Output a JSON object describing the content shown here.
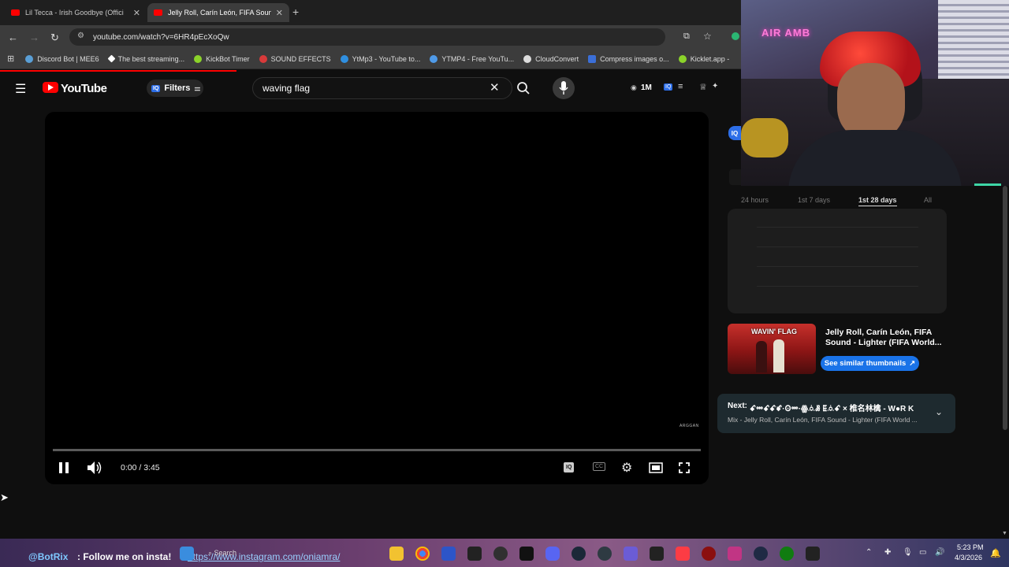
{
  "browser": {
    "tabs": [
      {
        "title": "Lil Tecca - Irish Goodbye (Offici"
      },
      {
        "title": "Jelly Roll, Carín León, FIFA Soun"
      }
    ],
    "new_tab_glyph": "+",
    "url": "youtube.com/watch?v=6HR4pEcXoQw",
    "bookmarks": [
      {
        "label": "Discord Bot | MEE6",
        "color": "#5a9fd6"
      },
      {
        "label": "The best streaming...",
        "color": "#ffffff"
      },
      {
        "label": "KickBot Timer",
        "color": "#8bd32a"
      },
      {
        "label": "SOUND EFFECTS",
        "color": "#d83a3a"
      },
      {
        "label": "YtMp3 - YouTube to...",
        "color": "#2f8fe0"
      },
      {
        "label": "YTMP4 - Free YouTu...",
        "color": "#4f9ae8"
      },
      {
        "label": "CloudConvert",
        "color": "#dddddd"
      },
      {
        "label": "Compress images o...",
        "color": "#3b6fd8"
      },
      {
        "label": "Kicklet.app -",
        "color": "#8bd32a"
      }
    ]
  },
  "youtube": {
    "logo_text": "YouTube",
    "filters_label": "Filters",
    "filters_badge": "IQ",
    "search_value": "waving flag",
    "views_label": "1M",
    "iq_badge": "IQ"
  },
  "player": {
    "time": "0:00 / 3:45",
    "watermark": "ARGGAN",
    "iq_badge": "IQ",
    "cc_label": "CC",
    "progress_fraction": 0.0
  },
  "side": {
    "iq_badge": "IQ",
    "time_filters": [
      {
        "label": "24 hours",
        "active": false
      },
      {
        "label": "1st 7 days",
        "active": false
      },
      {
        "label": "1st 28 days",
        "active": true
      },
      {
        "label": "All",
        "active": false
      }
    ],
    "video_title": "Jelly Roll, Carín León, FIFA Sound - Lighter (FIFA World...",
    "thumb_text": "WAVIN' FLAG",
    "similar_button": "See similar thumbnails",
    "next_label": "Next:",
    "next_title": "ꗃꗮꗃꗃꗄ·Ꙩꗮ·ꙮꗝꗡ ꗍꗝꗃ × 椎名林檎 - W●R K",
    "next_sub": "Mix - Jelly Roll, Carín León, FIFA Sound - Lighter (FIFA World ..."
  },
  "webcam": {
    "neon_sign": "AIR AMB"
  },
  "taskbar": {
    "overlay_user": "@BotRix",
    "overlay_text": ": Follow me on insta!",
    "overlay_link": "https://www.instagram.com/oniamra/",
    "search_label": "Search",
    "clock_time": "5:23 PM",
    "clock_date": "4/3/2026"
  }
}
